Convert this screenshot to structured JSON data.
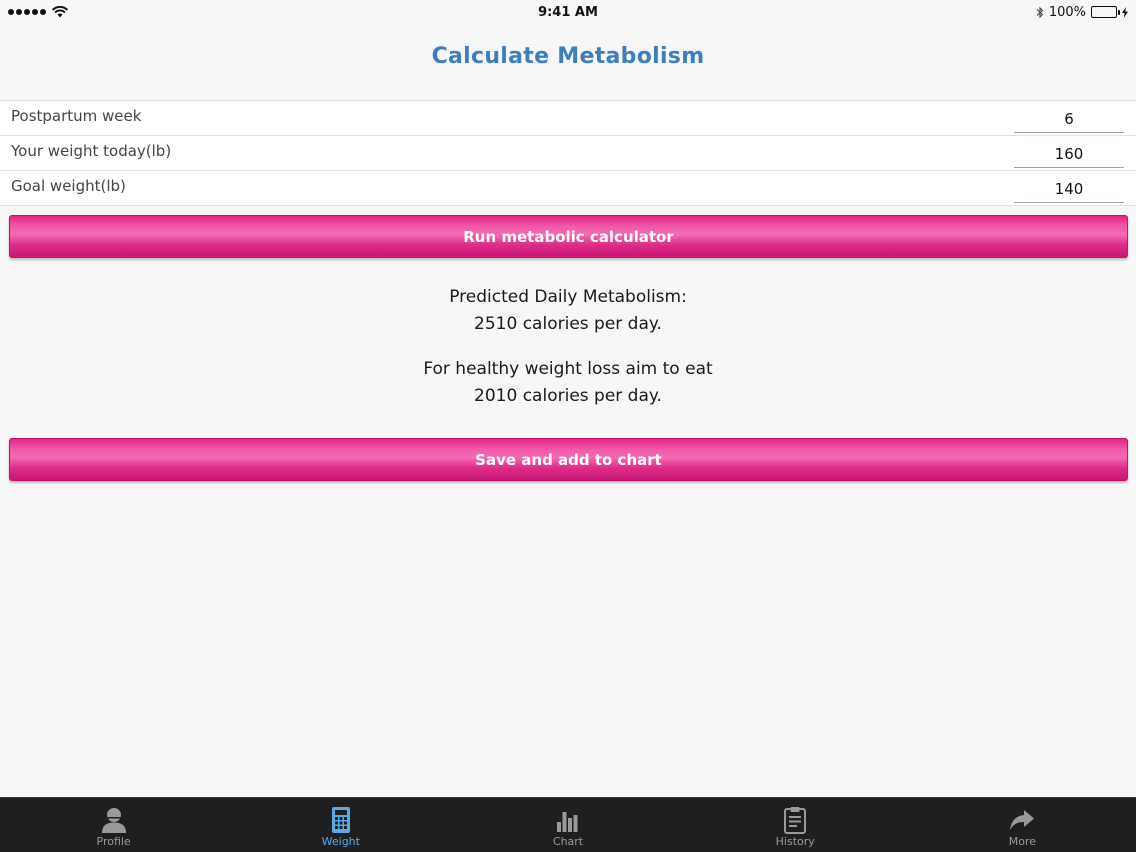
{
  "status_bar": {
    "time": "9:41 AM",
    "battery": "100%"
  },
  "header": {
    "title": "Calculate Metabolism"
  },
  "form": {
    "rows": [
      {
        "label": "Postpartum week",
        "value": "6"
      },
      {
        "label": "Your weight today(lb)",
        "value": "160"
      },
      {
        "label": "Goal weight(lb)",
        "value": "140"
      }
    ]
  },
  "actions": {
    "run_label": "Run metabolic calculator",
    "save_label": "Save and add to chart"
  },
  "results": {
    "metabolism_title": "Predicted Daily Metabolism:",
    "metabolism_value": "2510 calories per day.",
    "loss_title": "For healthy weight loss aim to eat",
    "loss_value": "2010 calories per day."
  },
  "tabs": [
    {
      "label": "Profile",
      "icon": "person-icon",
      "active": false
    },
    {
      "label": "Weight",
      "icon": "calculator-icon",
      "active": true
    },
    {
      "label": "Chart",
      "icon": "bar-chart-icon",
      "active": false
    },
    {
      "label": "History",
      "icon": "clipboard-icon",
      "active": false
    },
    {
      "label": "More",
      "icon": "share-arrow-icon",
      "active": false
    }
  ],
  "colors": {
    "title": "#3c7fbf",
    "button_pink": "#e22585",
    "tab_active": "#5aa8ea",
    "tab_inactive": "#9a9a9a",
    "tab_bar_bg": "#1f1f1f"
  }
}
